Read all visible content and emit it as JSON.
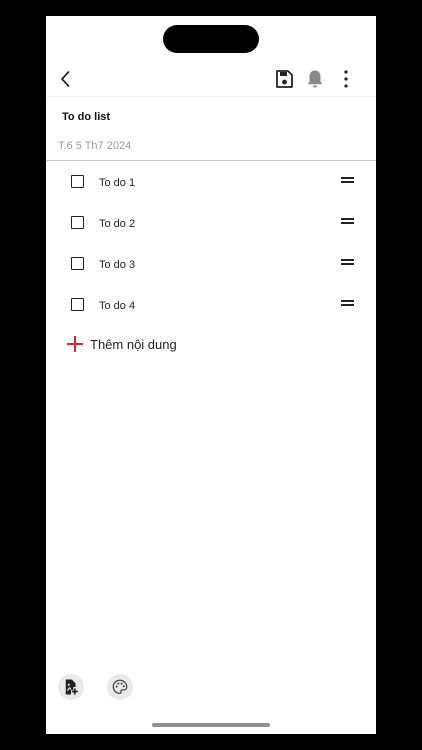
{
  "note": {
    "title": "To do list",
    "date": "T.6 5 Th7 2024"
  },
  "todos": [
    {
      "label": "To do 1",
      "checked": false
    },
    {
      "label": "To do 2",
      "checked": false
    },
    {
      "label": "To do 3",
      "checked": false
    },
    {
      "label": "To do 4",
      "checked": false
    }
  ],
  "add_item": {
    "label": "Thêm nội dung",
    "icon": "plus-icon",
    "color": "#e0262a"
  },
  "toolbar": {
    "icons": [
      "back-icon",
      "save-icon",
      "bell-icon",
      "more-vertical-icon"
    ]
  },
  "bottom_bar": {
    "icons": [
      "add-image-icon",
      "palette-icon"
    ]
  }
}
